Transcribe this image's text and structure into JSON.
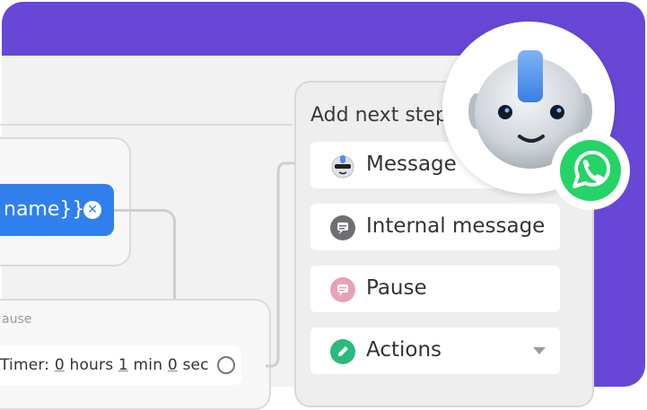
{
  "flow": {
    "chip_label": "name}}",
    "pause_node_title": "ause",
    "timer": {
      "label": "Timer:",
      "hours_value": "0",
      "hours_unit": "hours",
      "min_value": "1",
      "min_unit": "min",
      "sec_value": "0",
      "sec_unit": "sec"
    }
  },
  "panel": {
    "title": "Add next step",
    "options": [
      {
        "label": "Message",
        "icon": "bot-face-icon"
      },
      {
        "label": "Internal message",
        "icon": "internal-message-icon"
      },
      {
        "label": "Pause",
        "icon": "pause-icon"
      },
      {
        "label": "Actions",
        "icon": "pencil-icon"
      }
    ]
  },
  "colors": {
    "background_accent": "#6847d6",
    "chip_blue": "#2f80ed",
    "whatsapp_green": "#25d366",
    "pause_pink": "#e8a0b8",
    "actions_green": "#2db87d",
    "internal_gray": "#6e6e73"
  }
}
